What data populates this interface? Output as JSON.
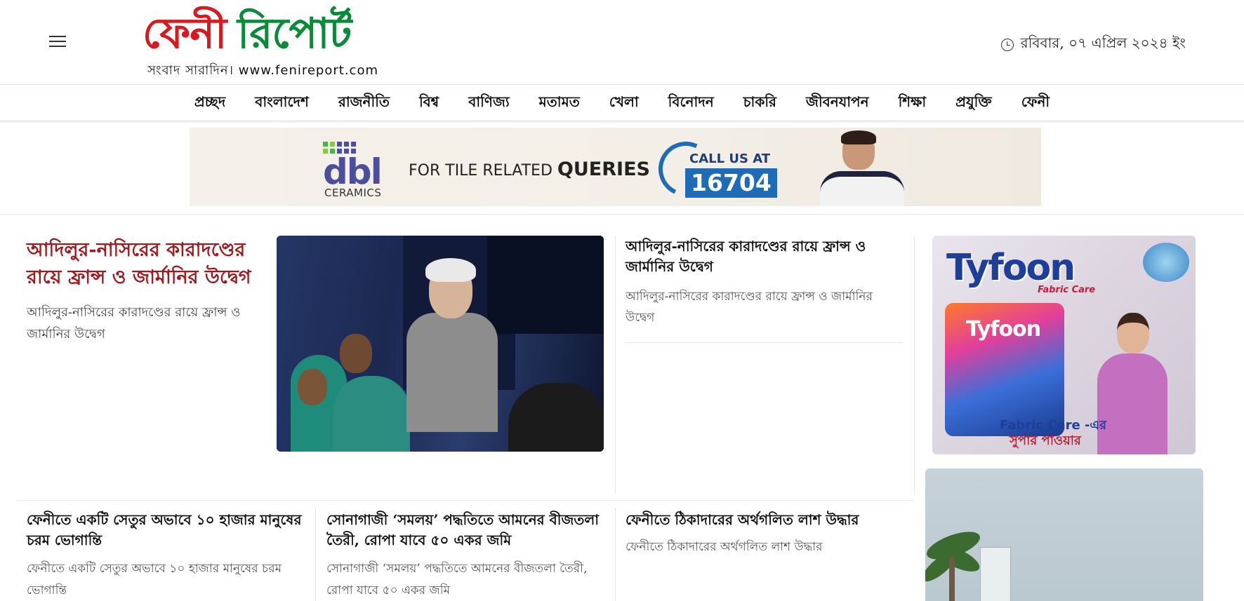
{
  "header": {
    "logo_main_red": "ফেনী",
    "logo_main_green": "রিপোর্ট",
    "logo_tagline": "সংবাদ সারাদিন। www.fenireport.com",
    "date": "রবিবার, ০৭ এপ্রিল ২০২৪ ইং"
  },
  "nav": {
    "items": [
      "প্রচ্ছদ",
      "বাংলাদেশ",
      "রাজনীতি",
      "বিশ্ব",
      "বাণিজ্য",
      "মতামত",
      "খেলা",
      "বিনোদন",
      "চাকরি",
      "জীবনযাপন",
      "শিক্ষা",
      "প্রযুক্তি",
      "ফেনী"
    ]
  },
  "banner_ad": {
    "brand": "dbl",
    "brand_sub": "CERAMICS",
    "query_text": "FOR TILE RELATED",
    "query_bold": "QUERIES",
    "call_label": "CALL US AT",
    "call_number": "16704",
    "accent_color": "#1e6bb8"
  },
  "lead": {
    "title": "আদিলুর-নাসিরের কারাদণ্ডের রায়ে ফ্রান্স ও জার্মানির উদ্বেগ",
    "summary": "আদিলুর-নাসিরের কারাদণ্ডের রায়ে ফ্রান্স ও জার্মানির উদ্বেগ",
    "title_color": "#a0191e"
  },
  "side_story": {
    "title": "আদিলুর-নাসিরের কারাদণ্ডের রায়ে ফ্রান্স ও জার্মানির উদ্বেগ",
    "summary": "আদিলুর-নাসিরের কারাদণ্ডের রায়ে ফ্রান্স ও জার্মানির উদ্বেগ"
  },
  "side_ad": {
    "brand": "Tyfoon",
    "sub": "Fabric Care",
    "pack_label": "Tyfoon",
    "footer_line1": "Fabric Care -এর",
    "footer_line2": "সুপার পাওয়ার"
  },
  "cards": [
    {
      "title": "ফেনীতে একটি সেতুর অভাবে ১০ হাজার মানুষের চরম ভোগান্তি",
      "summary": "ফেনীতে একটি সেতুর অভাবে ১০ হাজার মানুষের চরম ভোগান্তি"
    },
    {
      "title": "সোনাগাজী ‘সমলয়’ পদ্ধতিতে আমনের বীজতলা তৈরী, রোপা যাবে ৫০ একর জমি",
      "summary": "সোনাগাজী ‘সমলয়’ পদ্ধতিতে আমনের বীজতলা তৈরী, রোপা যাবে ৫০ একর জমি"
    },
    {
      "title": "ফেনীতে ঠিকাদারের অর্থগলিত লাশ উদ্ধার",
      "summary": "ফেনীতে ঠিকাদারের অর্থগলিত লাশ উদ্ধার"
    }
  ]
}
